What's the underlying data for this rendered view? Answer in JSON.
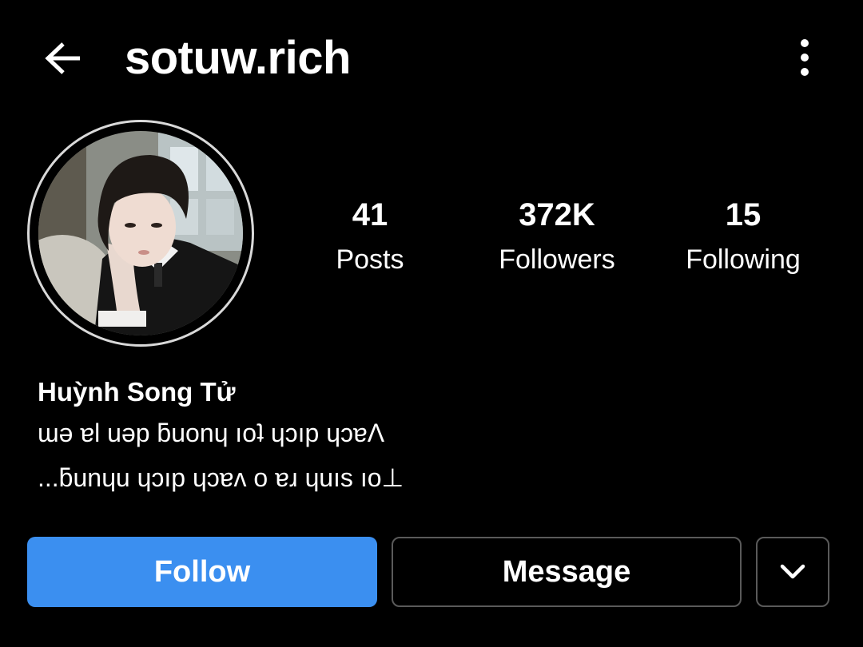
{
  "header": {
    "username": "sotuw.rich",
    "back_icon": "arrow-left-icon",
    "options_icon": "more-vertical-icon"
  },
  "profile": {
    "stats": [
      {
        "count": "41",
        "label": "Posts"
      },
      {
        "count": "372K",
        "label": "Followers"
      },
      {
        "count": "15",
        "label": "Following"
      }
    ],
    "full_name": "Huỳnh Song Tử",
    "bio_lines": [
      "ɯǝ ɐl uǝp ƃuonɥ ıoʇ ɥɔıp ɥɔɐΛ",
      "...ƃunɥu ɥɔıp ɥɔɐʌ o ɐɹ ɥuıs ıo⊥"
    ]
  },
  "actions": {
    "follow_label": "Follow",
    "message_label": "Message",
    "dropdown_icon": "chevron-down-icon"
  },
  "colors": {
    "background": "#000000",
    "follow_button": "#3b8ff0",
    "outline_button_border": "#5a5a5a",
    "avatar_ring": "#d9d9d9",
    "text": "#ffffff"
  }
}
